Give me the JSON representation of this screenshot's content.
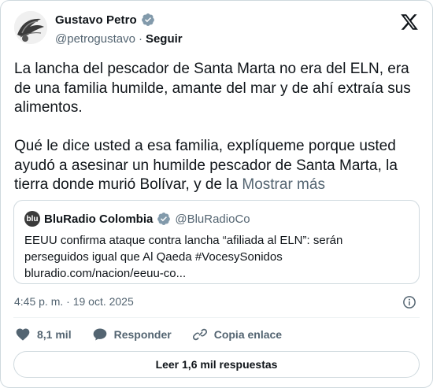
{
  "author": {
    "name": "Gustavo Petro",
    "handle": "@petrogustavo",
    "separator": "·",
    "follow_label": "Seguir"
  },
  "tweet": {
    "text": "La lancha del pescador de Santa Marta no era del ELN, era de una familia humilde, amante del mar y de ahí extraía sus alimentos.\n\nQué le dice usted a esa familia, explíqueme porque usted ayudó a asesinar un humilde pescador de Santa Marta, la tierra donde murió Bolívar, y de la ",
    "show_more": "Mostrar más"
  },
  "quote": {
    "avatar_text": "blu",
    "name": "BluRadio Colombia",
    "handle": "@BluRadioCo",
    "body": "EEUU confirma ataque contra lancha “afiliada al ELN”: serán perseguidos igual que Al Qaeda #VocesySonidos",
    "link": "bluradio.com/nacion/eeuu-co..."
  },
  "meta": {
    "timestamp": "4:45 p. m. · 19 oct. 2025"
  },
  "actions": {
    "likes": "8,1 mil",
    "reply": "Responder",
    "copy_link": "Copia enlace"
  },
  "replies_button": "Leer 1,6 mil respuestas",
  "colors": {
    "text": "#0f1419",
    "secondary": "#536471",
    "border": "#cfd9de"
  }
}
